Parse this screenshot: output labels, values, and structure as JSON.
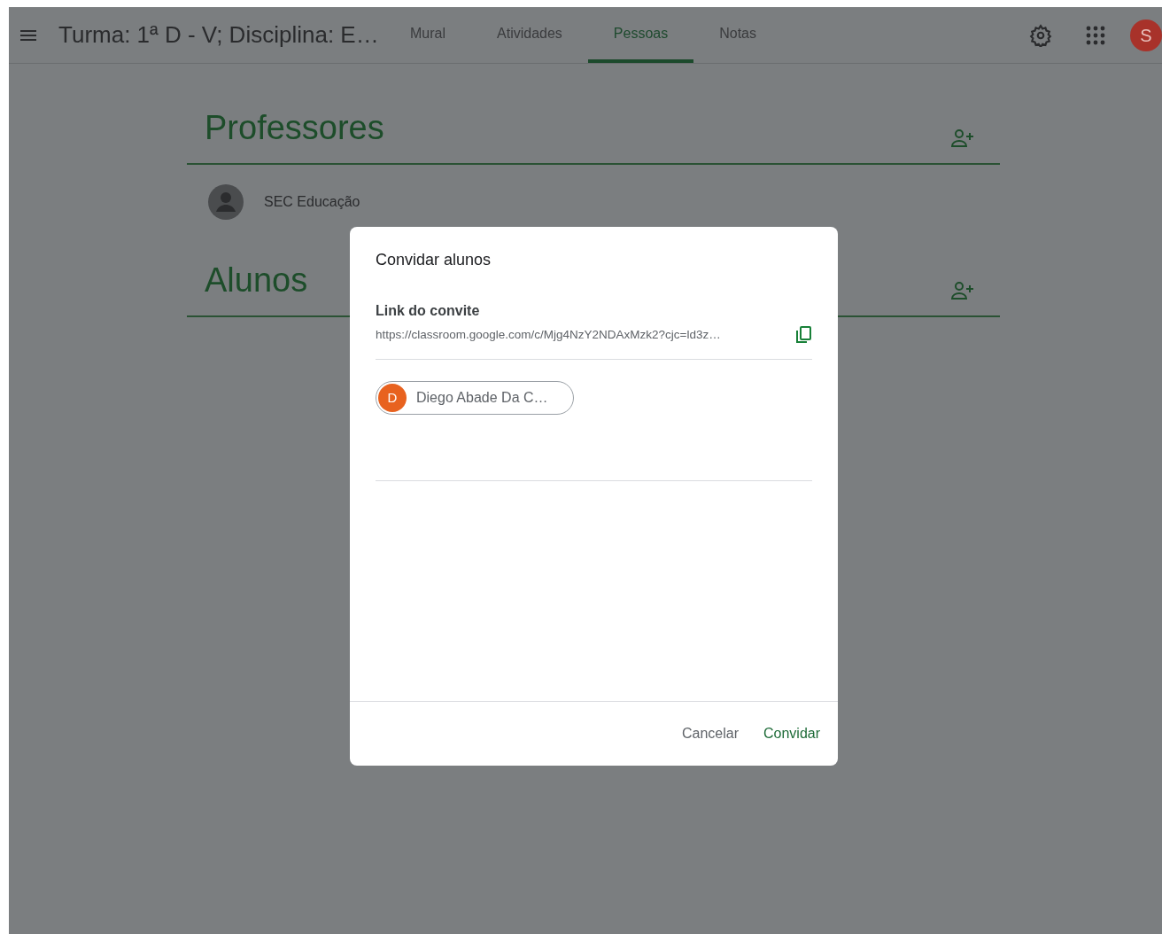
{
  "app_bar": {
    "title": "Turma: 1ª D - V; Disciplina: E…",
    "tabs": [
      {
        "label": "Mural",
        "selected": false
      },
      {
        "label": "Atividades",
        "selected": false
      },
      {
        "label": "Pessoas",
        "selected": true
      },
      {
        "label": "Notas",
        "selected": false
      }
    ],
    "avatar": "S"
  },
  "sections": [
    {
      "heading": "Professores",
      "people": [
        {
          "name": "SEC Educação"
        }
      ]
    },
    {
      "heading": "Alunos"
    }
  ],
  "dialog": {
    "title": "Convidar alunos",
    "link_label": "Link do convite",
    "link": "https://classroom.google.com/c/Mjg4NzY2NDAxMzk2?cjc=ld3z…",
    "recipients": [
      {
        "initial": "D",
        "name": "Diego Abade Da C…"
      }
    ],
    "buttons": [
      {
        "label": "Cancelar",
        "kind": "secondary"
      },
      {
        "label": "Convidar",
        "kind": "primary"
      }
    ]
  }
}
